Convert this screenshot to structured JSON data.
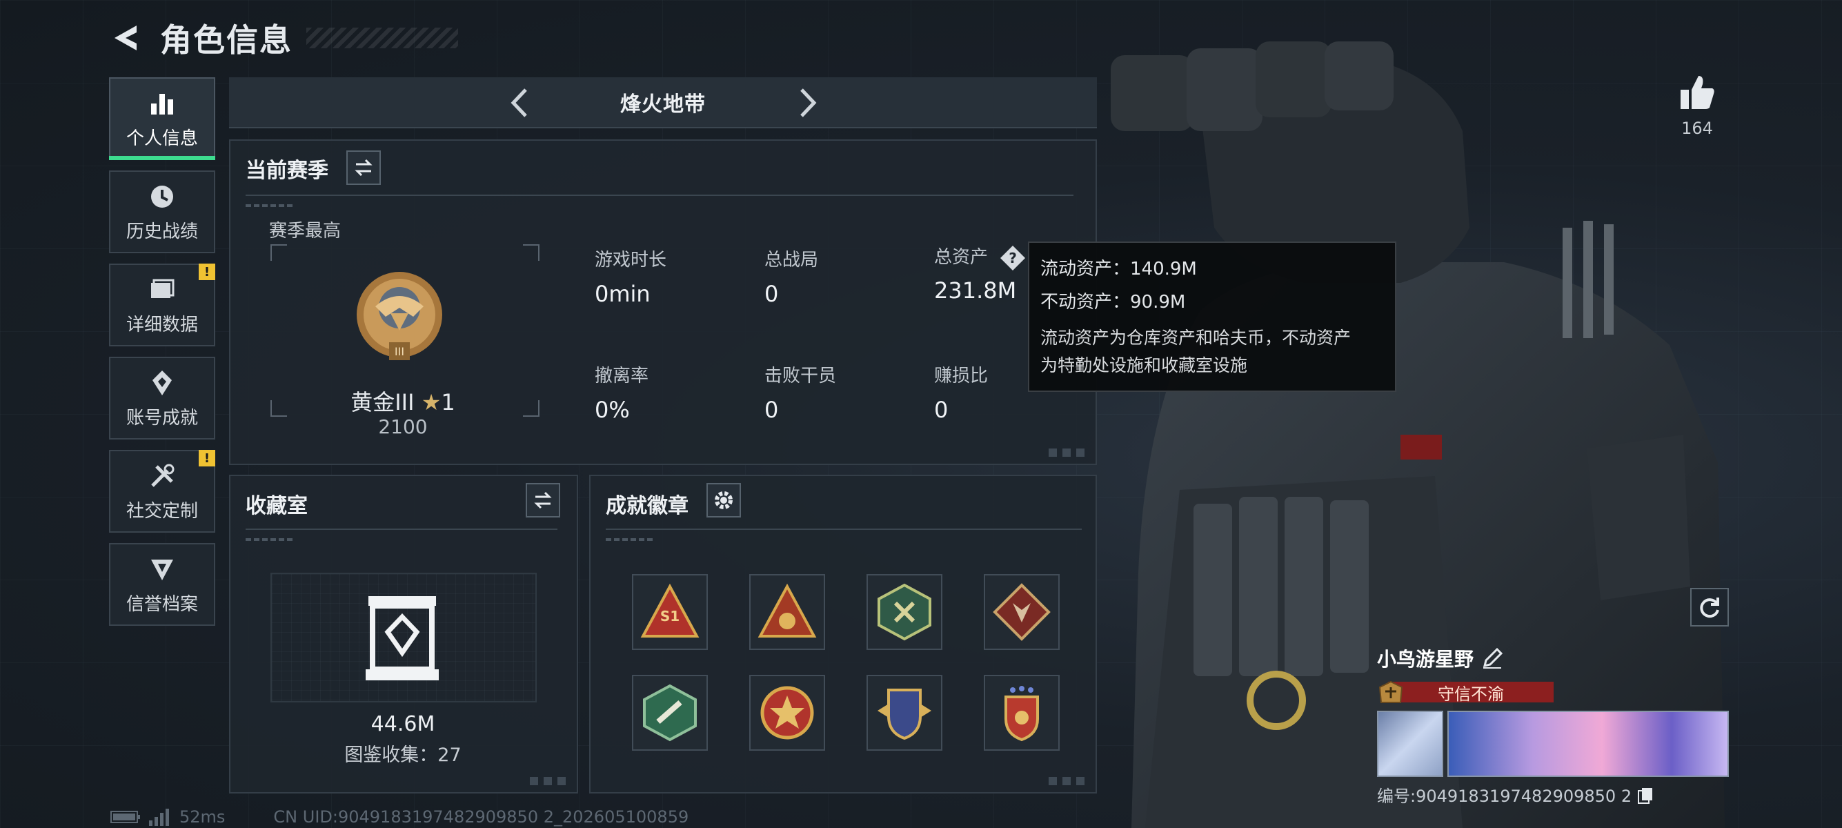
{
  "header": {
    "title": "角色信息",
    "back_icon": "back-arrow-icon"
  },
  "sidebar": {
    "items": [
      {
        "label": "个人信息",
        "icon": "bar-chart-icon",
        "active": true,
        "badge": ""
      },
      {
        "label": "历史战绩",
        "icon": "clock-icon",
        "active": false,
        "badge": ""
      },
      {
        "label": "详细数据",
        "icon": "folder-icon",
        "active": false,
        "badge": "!"
      },
      {
        "label": "账号成就",
        "icon": "achievement-icon",
        "active": false,
        "badge": ""
      },
      {
        "label": "社交定制",
        "icon": "tools-icon",
        "active": false,
        "badge": "!"
      },
      {
        "label": "信誉档案",
        "icon": "reputation-icon",
        "active": false,
        "badge": ""
      }
    ]
  },
  "mode": {
    "title": "烽火地带"
  },
  "season": {
    "title": "当前赛季",
    "best_label": "赛季最高",
    "rank_name": "黄金III",
    "rank_stars": "1",
    "rank_score": "2100",
    "stats": [
      {
        "label": "游戏时长",
        "value": "0min"
      },
      {
        "label": "总战局",
        "value": "0"
      },
      {
        "label": "总资产",
        "value": "231.8M"
      },
      {
        "label": "撤离率",
        "value": "0%"
      },
      {
        "label": "击败干员",
        "value": "0"
      },
      {
        "label": "赚损比",
        "value": "0"
      }
    ]
  },
  "tooltip": {
    "liquid": "流动资产：140.9M",
    "fixed": "不动资产：90.9M",
    "desc_line1": "流动资产为仓库资产和哈夫币，不动资产",
    "desc_line2": "为特勤处设施和收藏室设施"
  },
  "collection": {
    "title": "收藏室",
    "value": "44.6M",
    "count": "图鉴收集：27"
  },
  "badges": {
    "title": "成就徽章",
    "items": [
      "s1-badge-icon",
      "gold-triangle-badge-icon",
      "green-hex-badge-icon",
      "wolf-badge-icon",
      "green-tool-badge-icon",
      "star-medal-badge-icon",
      "shield-wing-badge-icon",
      "stars-shield-badge-icon"
    ],
    "s1_text": "S1"
  },
  "likes": {
    "count": "164"
  },
  "player": {
    "name": "小鸟游星野",
    "reputation": "守信不渝",
    "id_text": "编号:9049183197482909850 2"
  },
  "footer": {
    "ping": "52ms",
    "uid": "CN UID:9049183197482909850 2_202605100859"
  }
}
